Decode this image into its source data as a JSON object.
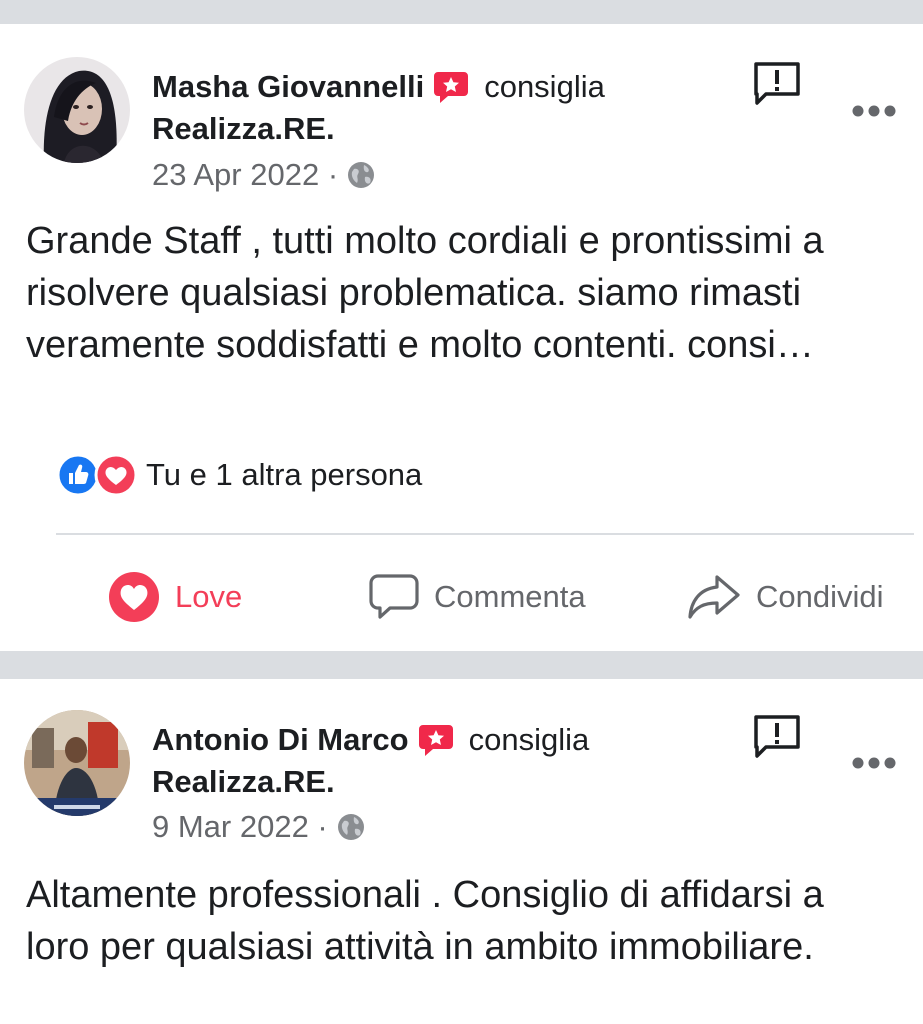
{
  "colors": {
    "love": "#f33e58",
    "like_blue": "#1877f2",
    "muted": "#65676b",
    "recommend_red": "#f0284a"
  },
  "posts": [
    {
      "author": "Masha Giovannelli",
      "verb": "consiglia",
      "page": "Realizza.RE.",
      "date": "23 Apr 2022 ·",
      "text_lines": [
        "Grande Staff , tutti molto cordiali e prontissimi a",
        "risolvere qualsiasi problematica. siamo rimasti",
        "veramente soddisfatti e molto contenti.  consi…"
      ],
      "reactions": {
        "icons": [
          "like-icon",
          "heart-icon"
        ],
        "text": "Tu e 1 altra persona"
      },
      "actions": {
        "love": "Love",
        "comment": "Commenta",
        "share": "Condividi"
      }
    },
    {
      "author": "Antonio Di Marco",
      "verb": "consiglia",
      "page": "Realizza.RE.",
      "date": "9 Mar 2022 ·",
      "text_lines": [
        "Altamente professionali . Consiglio di affidarsi a",
        "loro per qualsiasi attività in ambito immobiliare."
      ]
    }
  ]
}
